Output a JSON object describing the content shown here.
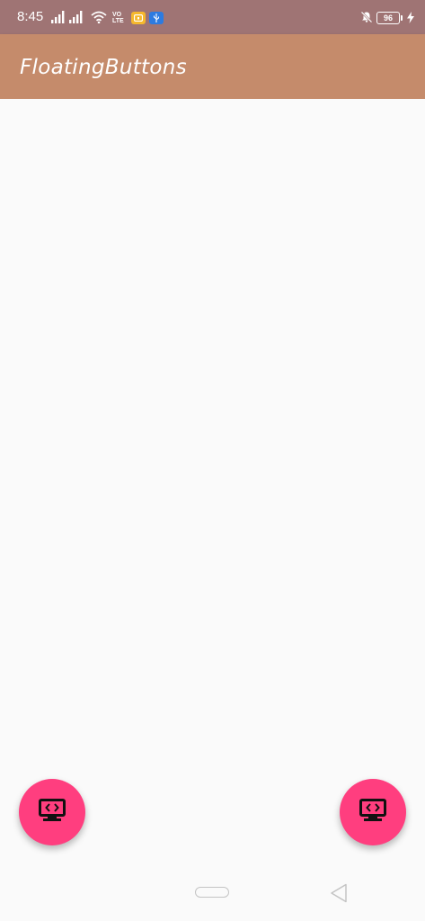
{
  "status_bar": {
    "time": "8:45",
    "volte_top": "VO",
    "volte_bottom": "LTE",
    "battery_level": "96",
    "icons": [
      "signal-icon",
      "signal-icon",
      "wifi-icon",
      "volte-icon",
      "app-notification-icon",
      "usb-icon",
      "mute-icon",
      "battery-icon",
      "charging-icon"
    ]
  },
  "app_bar": {
    "title": "FloatingButtons"
  },
  "fabs": [
    {
      "icon": "developer-mode-monitor-icon",
      "position": "bottom-left"
    },
    {
      "icon": "developer-mode-monitor-icon",
      "position": "bottom-right"
    }
  ],
  "nav_bar": {
    "icons": [
      "home-pill-icon",
      "back-icon"
    ]
  },
  "colors": {
    "status_bar": "#9f7474",
    "app_bar": "#c58b6b",
    "background": "#fafafa",
    "fab": "#ff3e7f"
  }
}
